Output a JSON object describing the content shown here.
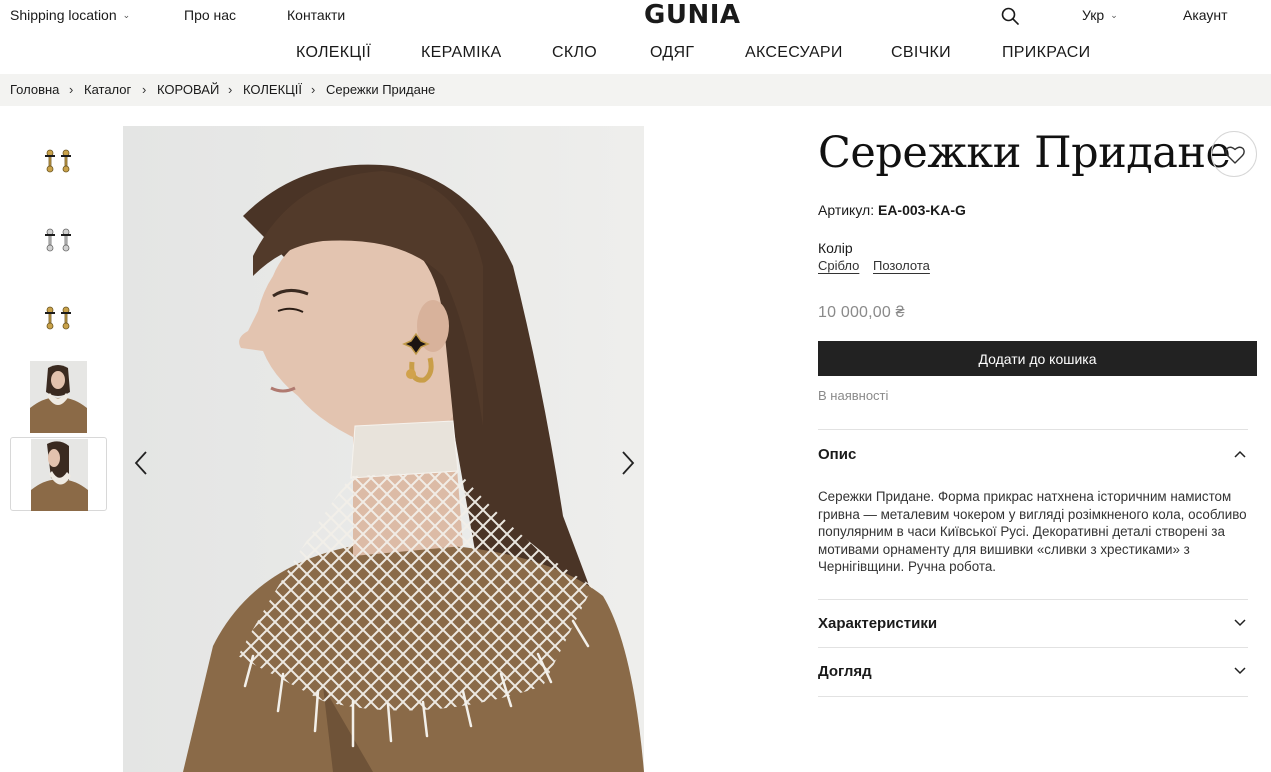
{
  "header": {
    "shipping": "Shipping location",
    "about": "Про нас",
    "contacts": "Контакти",
    "logo": "GUNIA",
    "language": "Укр",
    "account": "Акаунт"
  },
  "nav": [
    "КОЛЕКЦІЇ",
    "КЕРАМІКА",
    "СКЛО",
    "ОДЯГ",
    "АКСЕСУАРИ",
    "СВІЧКИ",
    "ПРИКРАСИ"
  ],
  "breadcrumb": [
    "Головна",
    "Каталог",
    "КОРОВАЙ",
    "КОЛЕКЦІЇ",
    "Сережки Придане"
  ],
  "breadcrumb_separator": "›",
  "product": {
    "title": "Сережки Придане",
    "sku_label": "Артикул:",
    "sku": "EA-003-KA-G",
    "color_label": "Колір",
    "color_options": [
      "Срібло",
      "Позолота"
    ],
    "price": "10 000,00 ₴",
    "add_to_cart": "Додати до кошика",
    "stock": "В наявності"
  },
  "accordion": {
    "description_title": "Опис",
    "description_text": "Сережки Придане. Форма прикрас натхнена історичним намистом гривна — металевим чокером у вигляді розімкненого кола, особливо популярним в часи Київської Русі. Декоративні деталі створені за мотивами орнаменту для вишивки «сливки з хрестиками» з Чернігівщини. Ручна робота.",
    "specs_title": "Характеристики",
    "care_title": "Догляд"
  },
  "icons": {
    "search": "search-icon",
    "favorite": "heart-icon",
    "prev": "chevron-left-icon",
    "next": "chevron-right-icon",
    "expand": "chevron-down-icon",
    "collapse": "chevron-up-icon"
  },
  "colors": {
    "button_bg": "#222222",
    "muted_text": "#8a8a8a",
    "breadcrumb_bg": "#f3f3f1"
  }
}
